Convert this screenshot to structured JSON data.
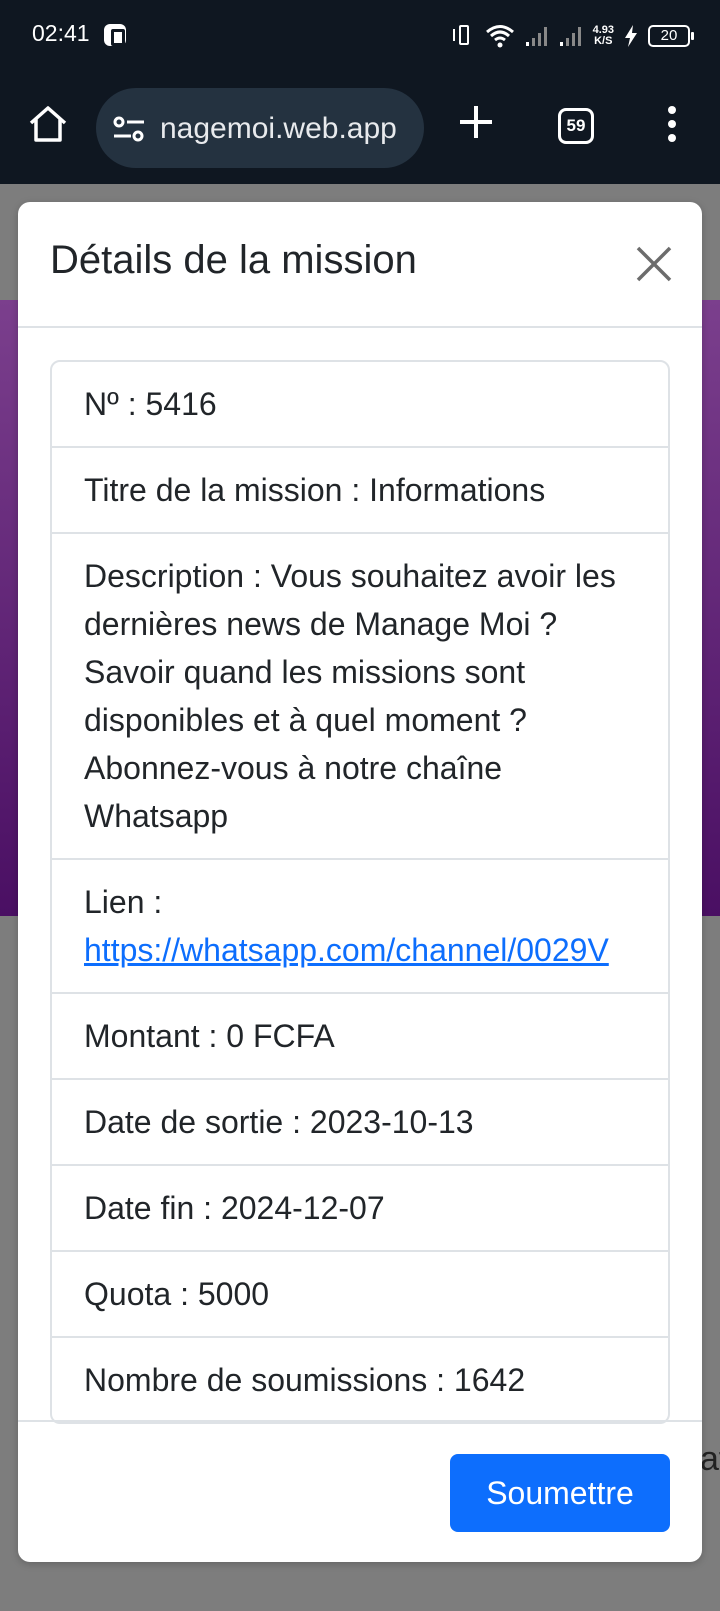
{
  "status_bar": {
    "time": "02:41",
    "net_speed_value": "4.93",
    "net_speed_unit": "K/S",
    "battery": "20"
  },
  "browser": {
    "url": "nagemoi.web.app",
    "tab_count": "59"
  },
  "page": {
    "peek_text": "at"
  },
  "modal": {
    "title": "Détails de la mission",
    "items": {
      "number": "Nº : 5416",
      "title": "Titre de la mission : Informations",
      "description": "Description : Vous souhaitez avoir les dernières news de Manage Moi ? Savoir quand les missions sont disponibles et à quel moment ? Abonnez-vous à notre chaîne Whatsapp",
      "link_label": "Lien :",
      "link_url": "https://whatsapp.com/channel/0029V",
      "amount": "Montant : 0 FCFA",
      "release_date": "Date de sortie : 2023-10-13",
      "end_date": "Date fin : 2024-12-07",
      "quota": "Quota : 5000",
      "submissions": "Nombre de soumissions : 1642"
    },
    "submit_label": "Soumettre"
  },
  "colors": {
    "primary": "#0d6efd",
    "browser_bar": "#0f1721",
    "purple_top": "#7b3f8d",
    "purple_bottom": "#4a0f63"
  }
}
